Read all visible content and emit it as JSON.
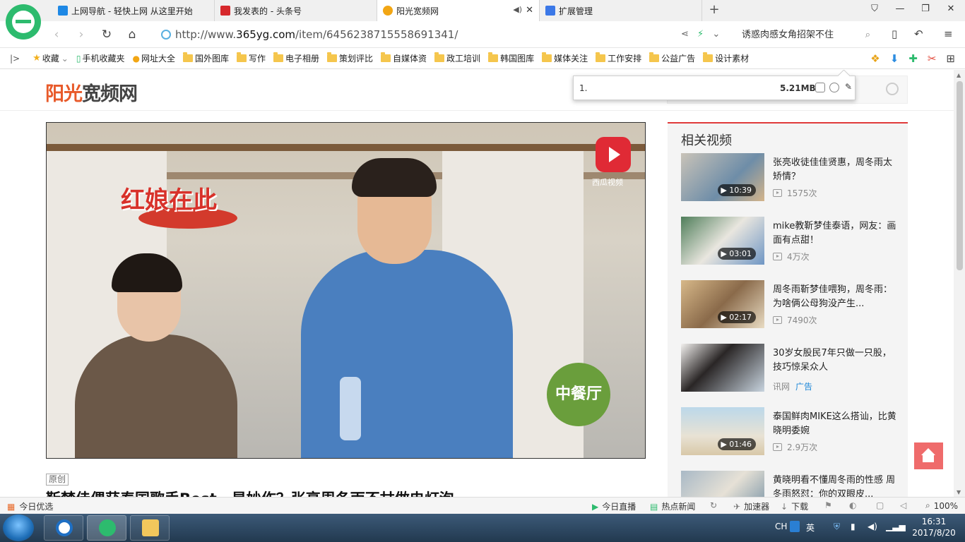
{
  "tabs": [
    {
      "title": "上网导航 - 轻快上网 从这里开始",
      "color": "#1e88e5"
    },
    {
      "title": "我发表的 - 头条号",
      "color": "#d6282c"
    },
    {
      "title": "阳光宽频网",
      "color": "#f2a614"
    },
    {
      "title": "扩展管理",
      "color": "#3b78e7"
    }
  ],
  "address": {
    "url_prefix": "http://www.",
    "url_domain": "365yg.com",
    "url_path": "/item/6456238715558691341/",
    "search_text": "诱惑肉感女角招架不住"
  },
  "bookmarks": [
    "收藏",
    "手机收藏夹",
    "网址大全",
    "国外图库",
    "写作",
    "电子相册",
    "策划评比",
    "自媒体资",
    "政工培训",
    "韩国图库",
    "媒体关注",
    "工作安排",
    "公益广告",
    "设计素材"
  ],
  "site": {
    "logo_a": "阳光",
    "logo_b": "宽频网"
  },
  "download_popup": {
    "name": "1.",
    "size": "5.21MB"
  },
  "video": {
    "overlay_text": "红娘在此",
    "watermark": "西瓜视频",
    "badge": "中餐厅"
  },
  "article": {
    "tag": "原创",
    "title": "靳梦佳偶获泰国歌手Best，星妙作？张亮周冬雨不甘做电灯泡"
  },
  "sidebar": {
    "heading": "相关视频",
    "items": [
      {
        "title": "张亮收徒佳佳贤惠，周冬雨太矫情？",
        "duration": "10:39",
        "count": "1575次",
        "ad": ""
      },
      {
        "title": "mike教靳梦佳泰语，网友：画面有点甜！",
        "duration": "03:01",
        "count": "4万次",
        "ad": ""
      },
      {
        "title": "周冬雨靳梦佳喂狗，周冬雨：为啥俩公母狗没产生...",
        "duration": "02:17",
        "count": "7490次",
        "ad": ""
      },
      {
        "title": "30岁女股民7年只做一只股，技巧惊呆众人",
        "duration": "",
        "count": "讯网",
        "ad": "广告"
      },
      {
        "title": "泰国鲜肉MIKE这么搭讪，比黄晓明委婉",
        "duration": "01:46",
        "count": "2.9万次",
        "ad": ""
      },
      {
        "title": "黄晓明看不懂周冬雨的性感 周冬雨怒怼：你的双眼皮...",
        "duration": "",
        "count": "",
        "ad": ""
      }
    ]
  },
  "statusbar": {
    "left": "今日优选",
    "live": "今日直播",
    "news": "热点新闻",
    "accel": "加速器",
    "download": "下载",
    "zoom": "100%"
  },
  "taskbar": {
    "lang": "CH",
    "ime": "英",
    "time": "16:31",
    "date": "2017/8/20"
  }
}
